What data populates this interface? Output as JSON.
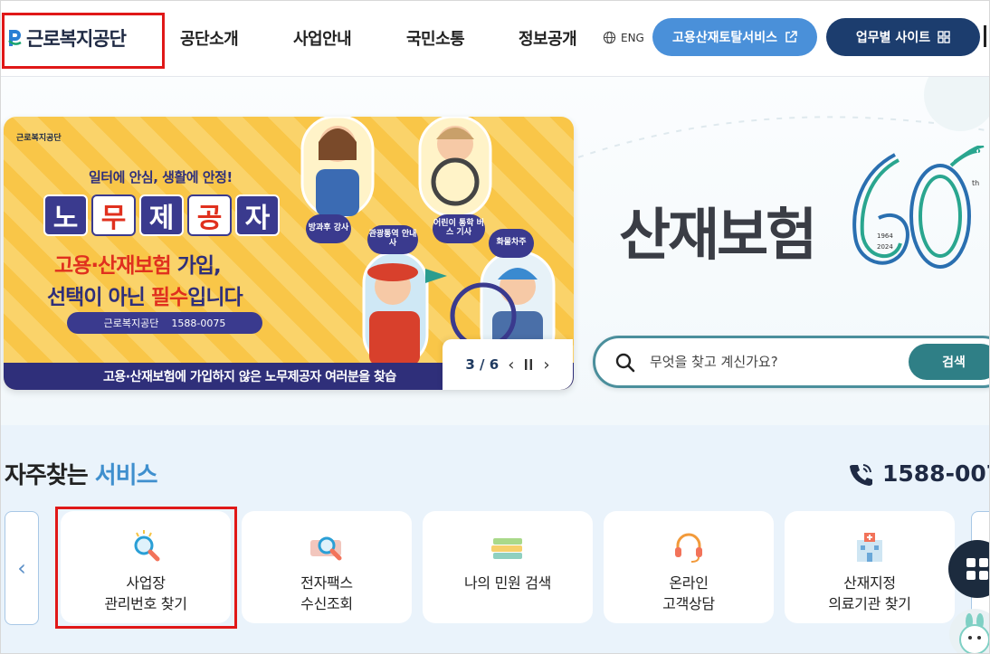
{
  "header": {
    "logo_text": "근로복지공단",
    "nav": [
      "공단소개",
      "사업안내",
      "국민소통",
      "정보공개"
    ],
    "lang_label": "ENG",
    "portal_button": "고용산재토탈서비스",
    "sites_button": "업무별 사이트"
  },
  "banner": {
    "org_line": "근로복지공단",
    "kicker": "일터에 안심, 생활에 안정!",
    "tiles": [
      "노",
      "무",
      "제",
      "공",
      "자"
    ],
    "line1_em": "고용·산재보험",
    "line1_rest": " 가입,",
    "line2_a": "선택이 아닌 ",
    "line2_em": "필수",
    "line2_b": "입니다",
    "pill_org": "근로복지공단",
    "pill_phone": "1588-0075",
    "footer": "고용·산재보험에 가입하지 않은 노무제공자 여러분을 찾습",
    "badges": [
      "방과후\n강사",
      "어린이 통학\n버스 기사",
      "관광통역\n안내사",
      "화물차주"
    ],
    "pager": {
      "current": "3",
      "total": "6",
      "count_text": "3 / 6"
    }
  },
  "hero": {
    "title": "산재보험",
    "sixty_years": [
      "1964",
      "2024"
    ],
    "sixty_suffix": "th"
  },
  "search": {
    "placeholder": "무엇을 찾고 계신가요?",
    "button": "검색"
  },
  "services": {
    "title_a": "자주찾는 ",
    "title_b": "서비스",
    "phone": "1588-007",
    "cards": [
      {
        "label": "사업장\n관리번호 찾기",
        "icon": "magnifier-icon"
      },
      {
        "label": "전자팩스\n수신조회",
        "icon": "fax-search-icon"
      },
      {
        "label": "나의 민원 검색",
        "icon": "books-icon"
      },
      {
        "label": "온라인\n고객상담",
        "icon": "headset-icon"
      },
      {
        "label": "산재지정\n의료기관 찾기",
        "icon": "hospital-icon"
      }
    ]
  },
  "colors": {
    "navy": "#1c3d6e",
    "blue": "#4a90d9",
    "teal": "#2f7f86",
    "highlight_box": "#e01818"
  }
}
